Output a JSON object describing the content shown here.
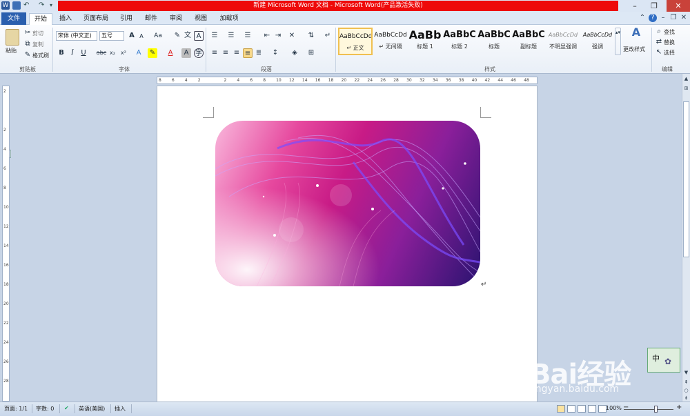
{
  "titlebar": {
    "title": "新建 Microsoft Word 文档 - Microsoft Word(产品激活失败)"
  },
  "tabs": [
    "文件",
    "开始",
    "插入",
    "页面布局",
    "引用",
    "邮件",
    "审阅",
    "视图",
    "加载项"
  ],
  "clipboard": {
    "paste": "粘贴",
    "cut": "剪切",
    "copy": "复制",
    "format_painter": "格式刷",
    "label": "剪贴板"
  },
  "font": {
    "name": "宋体 (中文正)",
    "size": "五号",
    "label": "字体",
    "bold": "B",
    "italic": "I",
    "underline": "U",
    "strike": "abc",
    "sub": "x₂",
    "sup": "x²",
    "aa": "Aa",
    "grow": "A",
    "shrink": "A",
    "text_a": "A",
    "text_a2": "A"
  },
  "paragraph": {
    "label": "段落"
  },
  "styles": {
    "label": "样式",
    "items": [
      {
        "sample": "AaBbCcDd",
        "name": "↵ 正文"
      },
      {
        "sample": "AaBbCcDd",
        "name": "↵ 无间隔"
      },
      {
        "sample": "AaBb",
        "name": "标题 1"
      },
      {
        "sample": "AaBbC",
        "name": "标题 2"
      },
      {
        "sample": "AaBbC",
        "name": "标题"
      },
      {
        "sample": "AaBbC",
        "name": "副标题"
      },
      {
        "sample": "AaBbCcDd",
        "name": "不明显强调"
      },
      {
        "sample": "AaBbCcDd",
        "name": "强调"
      }
    ],
    "change": "更改样式"
  },
  "editing": {
    "label": "编辑",
    "find": "查找",
    "replace": "替换",
    "select": "选择"
  },
  "ruler": {
    "ticks": [
      "8",
      "6",
      "4",
      "2",
      "",
      "2",
      "4",
      "6",
      "8",
      "10",
      "12",
      "14",
      "16",
      "18",
      "20",
      "22",
      "24",
      "26",
      "28",
      "30",
      "32",
      "34",
      "36",
      "38",
      "40",
      "42",
      "44",
      "46",
      "48"
    ]
  },
  "vruler": {
    "ticks": [
      "2",
      "",
      "2",
      "4",
      "6",
      "8",
      "10",
      "12",
      "14",
      "16",
      "18",
      "20",
      "22",
      "24",
      "26",
      "28"
    ]
  },
  "statusbar": {
    "page": "页面: 1/1",
    "words": "字数: 0",
    "lang": "英语(美国)",
    "mode": "插入",
    "zoom": "100%"
  },
  "ime": {
    "label": "中"
  },
  "watermark": {
    "text": "Bai经验",
    "url": "jingyan.baidu.com"
  }
}
